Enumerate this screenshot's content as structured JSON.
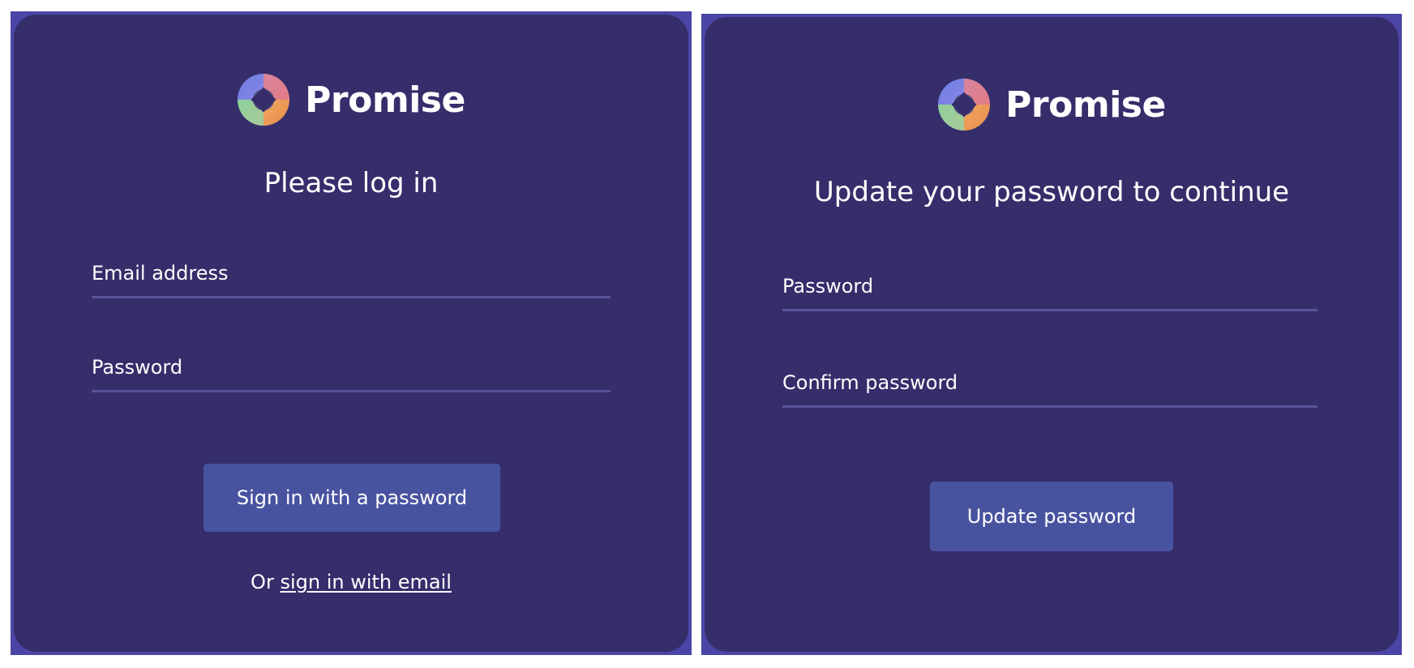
{
  "login_panel": {
    "brand_name": "Promise",
    "heading": "Please log in",
    "email_placeholder": "Email address",
    "password_placeholder": "Password",
    "submit_label": "Sign in with a password",
    "alt_prefix": "Or",
    "alt_link": "sign in with email"
  },
  "update_panel": {
    "brand_name": "Promise",
    "heading": "Update your password to continue",
    "password_placeholder": "Password",
    "confirm_placeholder": "Confirm password",
    "submit_label": "Update password"
  },
  "colors": {
    "frame": "#4b45a6",
    "card": "#352e6b",
    "button": "#4853a0",
    "field_underline": "#5a5398",
    "text": "#ffffff"
  }
}
